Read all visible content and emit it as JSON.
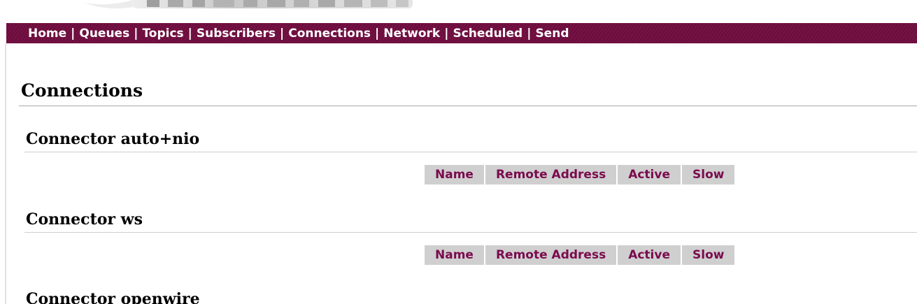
{
  "nav": {
    "items": [
      {
        "label": "Home"
      },
      {
        "label": "Queues"
      },
      {
        "label": "Topics"
      },
      {
        "label": "Subscribers"
      },
      {
        "label": "Connections"
      },
      {
        "label": "Network"
      },
      {
        "label": "Scheduled"
      },
      {
        "label": "Send"
      }
    ],
    "separator": "|"
  },
  "page_title": "Connections",
  "table_headers": [
    "Name",
    "Remote Address",
    "Active",
    "Slow"
  ],
  "connectors": [
    {
      "title": "Connector auto+nio"
    },
    {
      "title": "Connector ws"
    },
    {
      "title": "Connector openwire"
    }
  ],
  "colors": {
    "nav_background": "#6e0c3e",
    "header_text": "#7a0b4e",
    "header_background": "#cfcfcf"
  }
}
